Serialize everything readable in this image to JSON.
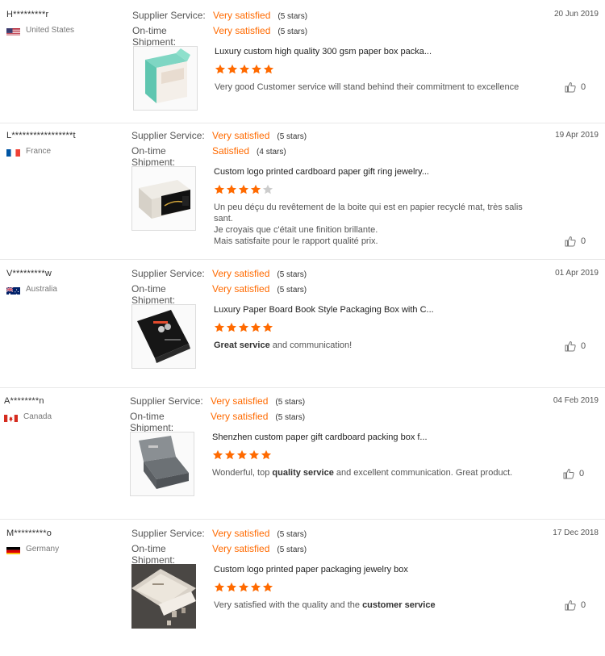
{
  "labels": {
    "supplier_service": "Supplier Service:",
    "ontime_shipment": "On-time Shipment:"
  },
  "colors": {
    "accent": "#ff6a00",
    "star_off": "#cccccc"
  },
  "reviews": [
    {
      "buyer": "H*********r",
      "country": "United States",
      "flag_icon": "us-flag-icon",
      "date": "20 Jun 2019",
      "supplier_service": {
        "value": "Very satisfied",
        "stars_text": "(5 stars)"
      },
      "ontime_shipment": {
        "value": "Very satisfied",
        "stars_text": "(5 stars)"
      },
      "product_title": "Luxury custom high quality 300 gsm paper box packa...",
      "rating": 5,
      "comment": [
        "Very good Customer service will stand behind their commitment to excellence"
      ],
      "likes": "0"
    },
    {
      "buyer": "L*****************t",
      "country": "France",
      "flag_icon": "fr-flag-icon",
      "date": "19 Apr 2019",
      "supplier_service": {
        "value": "Very satisfied",
        "stars_text": "(5 stars)"
      },
      "ontime_shipment": {
        "value": "Satisfied",
        "stars_text": "(4 stars)"
      },
      "product_title": "Custom logo printed cardboard paper gift ring jewelry...",
      "rating": 4,
      "comment": [
        "Un peu déçu du revêtement de la boite qui est en papier recyclé mat, très salis sant.",
        "Je croyais que c'était une finition brillante.",
        "Mais satisfaite pour le rapport qualité prix."
      ],
      "likes": "0"
    },
    {
      "buyer": "V*********w",
      "country": "Australia",
      "flag_icon": "au-flag-icon",
      "date": "01 Apr 2019",
      "supplier_service": {
        "value": "Very satisfied",
        "stars_text": "(5 stars)"
      },
      "ontime_shipment": {
        "value": "Very satisfied",
        "stars_text": "(5 stars)"
      },
      "product_title": "Luxury Paper Board Book Style Packaging Box with C...",
      "rating": 5,
      "comment_parts": {
        "bold1": "Great service",
        "rest1": " and communication!"
      },
      "likes": "0"
    },
    {
      "buyer": "A********n",
      "country": "Canada",
      "flag_icon": "ca-flag-icon",
      "date": "04 Feb 2019",
      "supplier_service": {
        "value": "Very satisfied",
        "stars_text": "(5 stars)"
      },
      "ontime_shipment": {
        "value": "Very satisfied",
        "stars_text": "(5 stars)"
      },
      "product_title": "Shenzhen custom paper gift cardboard packing box f...",
      "rating": 5,
      "comment_parts": {
        "pre": "Wonderful, top ",
        "bold": "quality service",
        "post": " and excellent communication. Great product."
      },
      "likes": "0"
    },
    {
      "buyer": "M*********o",
      "country": "Germany",
      "flag_icon": "de-flag-icon",
      "date": "17 Dec 2018",
      "supplier_service": {
        "value": "Very satisfied",
        "stars_text": "(5 stars)"
      },
      "ontime_shipment": {
        "value": "Very satisfied",
        "stars_text": "(5 stars)"
      },
      "product_title": "Custom logo printed paper packaging jewelry box",
      "rating": 5,
      "comment_parts": {
        "pre": "Very satisfied with the quality and the ",
        "bold": "customer service"
      },
      "likes": "0"
    }
  ]
}
